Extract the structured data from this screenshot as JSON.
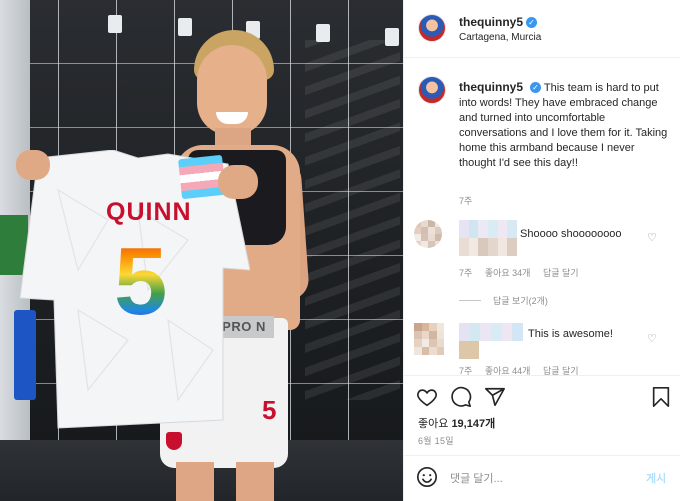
{
  "post": {
    "username": "thequinny5",
    "location": "Cartagena, Murcia",
    "caption": "This team is hard to put into words! They have embraced change and turned into uncomfortable conversations and I love them for it. Taking home this armband because I never thought I'd see this day!!",
    "caption_time": "7주"
  },
  "photo": {
    "jersey_name": "QUINN",
    "jersey_number": "5",
    "waistband_text": "PRO N",
    "shorts_number": "5"
  },
  "comments": [
    {
      "text": "Shoooo shoooooooo",
      "time": "7주",
      "likes": "좋아요 34개",
      "reply": "답글 달기",
      "view_replies": "답글 보기(2개)"
    },
    {
      "text": "This is awesome!",
      "time": "7주",
      "likes": "좋아요 44개",
      "reply": "답글 달기"
    }
  ],
  "stats": {
    "likes_label": "좋아요",
    "likes_count": "19,147개",
    "date": "6월 15일"
  },
  "composer": {
    "placeholder": "댓글 달기...",
    "post_label": "게시"
  },
  "icons": {
    "like": "heart-icon",
    "comment": "comment-icon",
    "share": "share-icon",
    "save": "bookmark-icon",
    "emoji": "emoji-icon"
  },
  "colors": {
    "verified": "#3897f0",
    "post_button": "#b2dffc",
    "secondary_text": "#8e8e8e"
  }
}
